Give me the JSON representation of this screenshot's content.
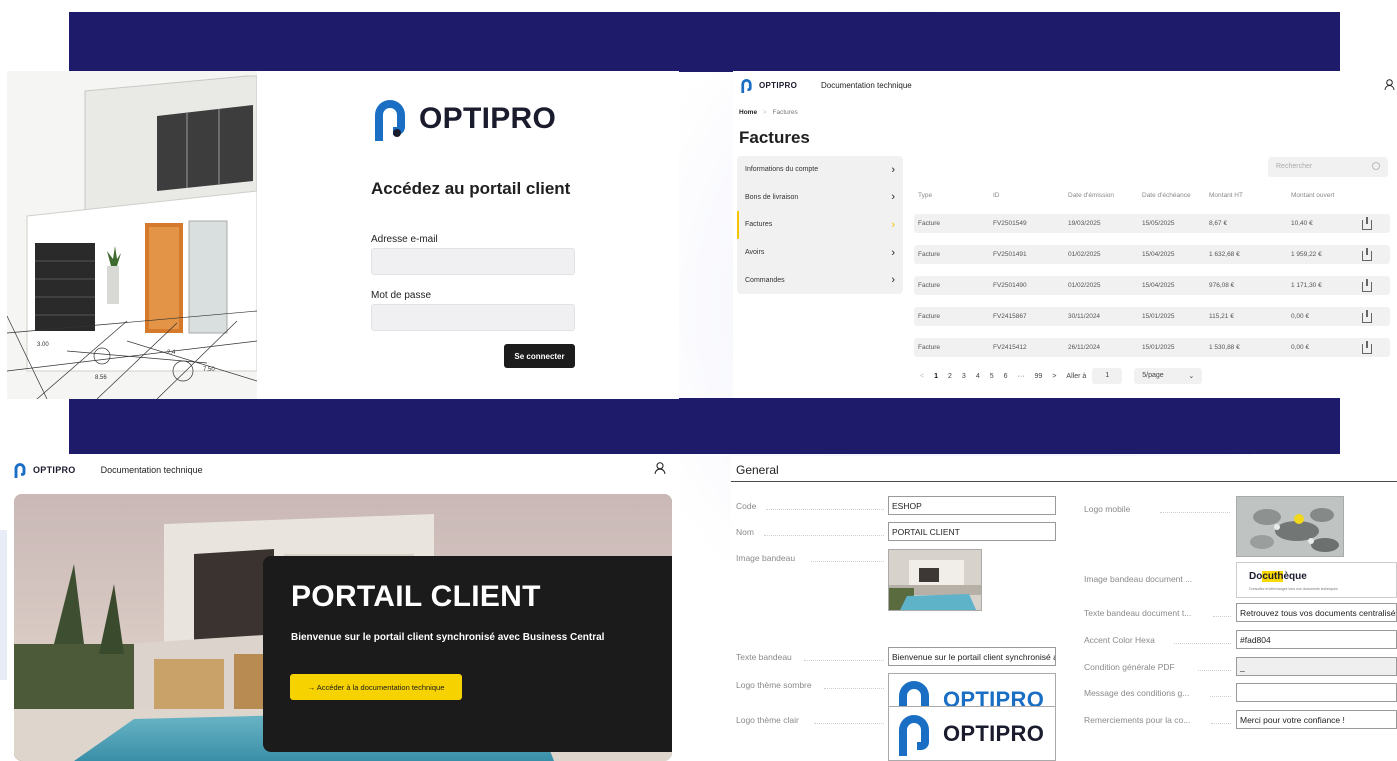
{
  "colors": {
    "brand_navy": "#1e1b6b",
    "accent_yellow": "#f6d200",
    "logo_blue": "#1a6fc4"
  },
  "brand": {
    "name": "OPTIPRO",
    "nav_link": "Documentation technique"
  },
  "login": {
    "title": "Accédez au portail client",
    "email_label": "Adresse e-mail",
    "password_label": "Mot de passe",
    "submit": "Se connecter"
  },
  "invoices": {
    "breadcrumb": {
      "home": "Home",
      "separator": ">",
      "current": "Factures"
    },
    "title": "Factures",
    "side_items": [
      {
        "label": "Informations du compte"
      },
      {
        "label": "Bons de livraison"
      },
      {
        "label": "Factures"
      },
      {
        "label": "Avoirs"
      },
      {
        "label": "Commandes"
      }
    ],
    "search_placeholder": "Rechercher",
    "columns": [
      "Type",
      "ID",
      "Date d'émission",
      "Date d'échéance",
      "Montant HT",
      "Montant ouvert"
    ],
    "rows": [
      [
        "Facture",
        "FV2501549",
        "19/03/2025",
        "15/05/2025",
        "8,67 €",
        "10,40 €"
      ],
      [
        "Facture",
        "FV2501491",
        "01/02/2025",
        "15/04/2025",
        "1 632,68 €",
        "1 959,22 €"
      ],
      [
        "Facture",
        "FV2501490",
        "01/02/2025",
        "15/04/2025",
        "976,08 €",
        "1 171,30 €"
      ],
      [
        "Facture",
        "FV2415867",
        "30/11/2024",
        "15/01/2025",
        "115,21 €",
        "0,00 €"
      ],
      [
        "Facture",
        "FV2415412",
        "26/11/2024",
        "15/01/2025",
        "1 530,88 €",
        "0,00 €"
      ]
    ],
    "pager": {
      "prev": "<",
      "pages": [
        "1",
        "2",
        "3",
        "4",
        "5",
        "6",
        "···",
        "99"
      ],
      "next": ">",
      "goto_label": "Aller à",
      "goto_value": "1",
      "page_size": "5/page",
      "page_size_chevron": "⌄"
    }
  },
  "home": {
    "hero_title": "PORTAIL CLIENT",
    "hero_subtitle": "Bienvenue sur le portail client synchronisé avec Business Central",
    "cta": "→ Accéder à la documentation technique"
  },
  "settings": {
    "section_title": "General",
    "left": {
      "code": {
        "label": "Code",
        "value": "ESHOP"
      },
      "nom": {
        "label": "Nom",
        "value": "PORTAIL CLIENT"
      },
      "image_bandeau": {
        "label": "Image bandeau"
      },
      "texte_bandeau": {
        "label": "Texte bandeau",
        "value": "Bienvenue sur le portail client synchronisé avec Business Central"
      },
      "logo_sombre": {
        "label": "Logo thème sombre"
      },
      "logo_clair": {
        "label": "Logo thème clair"
      }
    },
    "right": {
      "logo_mobile": {
        "label": "Logo mobile"
      },
      "image_bandeau_doc": {
        "label": "Image bandeau document ...",
        "brand_pre": "Do",
        "brand_mark": "cuth",
        "brand_post": "èque",
        "tagline": "Consultez et téléchargez tous nos documents techniques"
      },
      "texte_bandeau_doc": {
        "label": "Texte bandeau document t...",
        "value": "Retrouvez tous vos documents centralisés"
      },
      "accent_color": {
        "label": "Accent Color Hexa",
        "value": "#fad804"
      },
      "condition_pdf": {
        "label": "Condition générale PDF",
        "value": "_"
      },
      "message_conditions": {
        "label": "Message des conditions g...",
        "value": ""
      },
      "remerciements": {
        "label": "Remerciements pour la co...",
        "value": "Merci pour votre confiance !"
      }
    }
  }
}
